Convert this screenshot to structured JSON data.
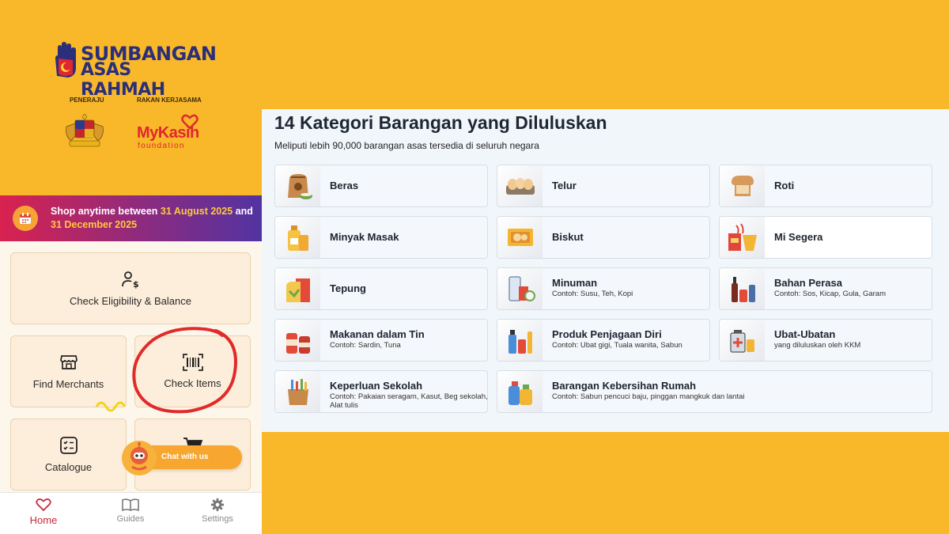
{
  "app": {
    "logo_line1": "SUMBANGAN",
    "logo_line2": "ASAS RAHMAH",
    "partner_label_1": "PENERAJU",
    "partner_label_2": "RAKAN KERJASAMA",
    "partner_name": "MyKasih",
    "partner_sub": "foundation"
  },
  "banner": {
    "prefix": "Shop anytime between ",
    "date1": "31 August 2025",
    "mid": " and ",
    "date2": "31 December 2025"
  },
  "tiles": {
    "eligibility": "Check Eligibility & Balance",
    "merchants": "Find Merchants",
    "check_items": "Check Items",
    "catalogue": "Catalogue"
  },
  "chat": {
    "label": "Chat with us"
  },
  "nav": {
    "home": "Home",
    "guides": "Guides",
    "settings": "Settings"
  },
  "panel": {
    "title": "14 Kategori Barangan yang Diluluskan",
    "subtitle": "Meliputi lebih 90,000 barangan asas tersedia di seluruh negara",
    "categories": [
      {
        "name": "Beras",
        "desc": "",
        "icon": "rice-sack-icon"
      },
      {
        "name": "Telur",
        "desc": "",
        "icon": "eggs-icon"
      },
      {
        "name": "Roti",
        "desc": "",
        "icon": "bread-icon"
      },
      {
        "name": "Minyak Masak",
        "desc": "",
        "icon": "cooking-oil-icon"
      },
      {
        "name": "Biskut",
        "desc": "",
        "icon": "biscuit-icon"
      },
      {
        "name": "Mi Segera",
        "desc": "",
        "icon": "instant-noodle-icon"
      },
      {
        "name": "Tepung",
        "desc": "",
        "icon": "flour-icon"
      },
      {
        "name": "Minuman",
        "desc": "Contoh: Susu, Teh, Kopi",
        "icon": "drinks-icon"
      },
      {
        "name": "Bahan Perasa",
        "desc": "Contoh: Sos, Kicap, Gula, Garam",
        "icon": "condiments-icon"
      },
      {
        "name": "Makanan dalam Tin",
        "desc": "Contoh: Sardin, Tuna",
        "icon": "canned-food-icon"
      },
      {
        "name": "Produk Penjagaan Diri",
        "desc": "Contoh: Ubat gigi, Tuala wanita, Sabun",
        "icon": "personal-care-icon"
      },
      {
        "name": "Ubat-Ubatan",
        "desc": "yang diluluskan oleh KKM",
        "icon": "medicine-icon"
      },
      {
        "name": "Keperluan Sekolah",
        "desc": "Contoh: Pakaian seragam, Kasut, Beg sekolah, Alat tulis",
        "icon": "school-supplies-icon"
      },
      {
        "name": "Barangan Kebersihan Rumah",
        "desc": "Contoh: Sabun pencuci baju, pinggan mangkuk dan lantai",
        "icon": "cleaning-supplies-icon"
      }
    ]
  },
  "colors": {
    "background": "#F8B82A",
    "brand_navy": "#2B2E7A",
    "mykasih_red": "#E0262E",
    "home_active": "#C6283A",
    "highlight_date": "#FFC93C"
  }
}
